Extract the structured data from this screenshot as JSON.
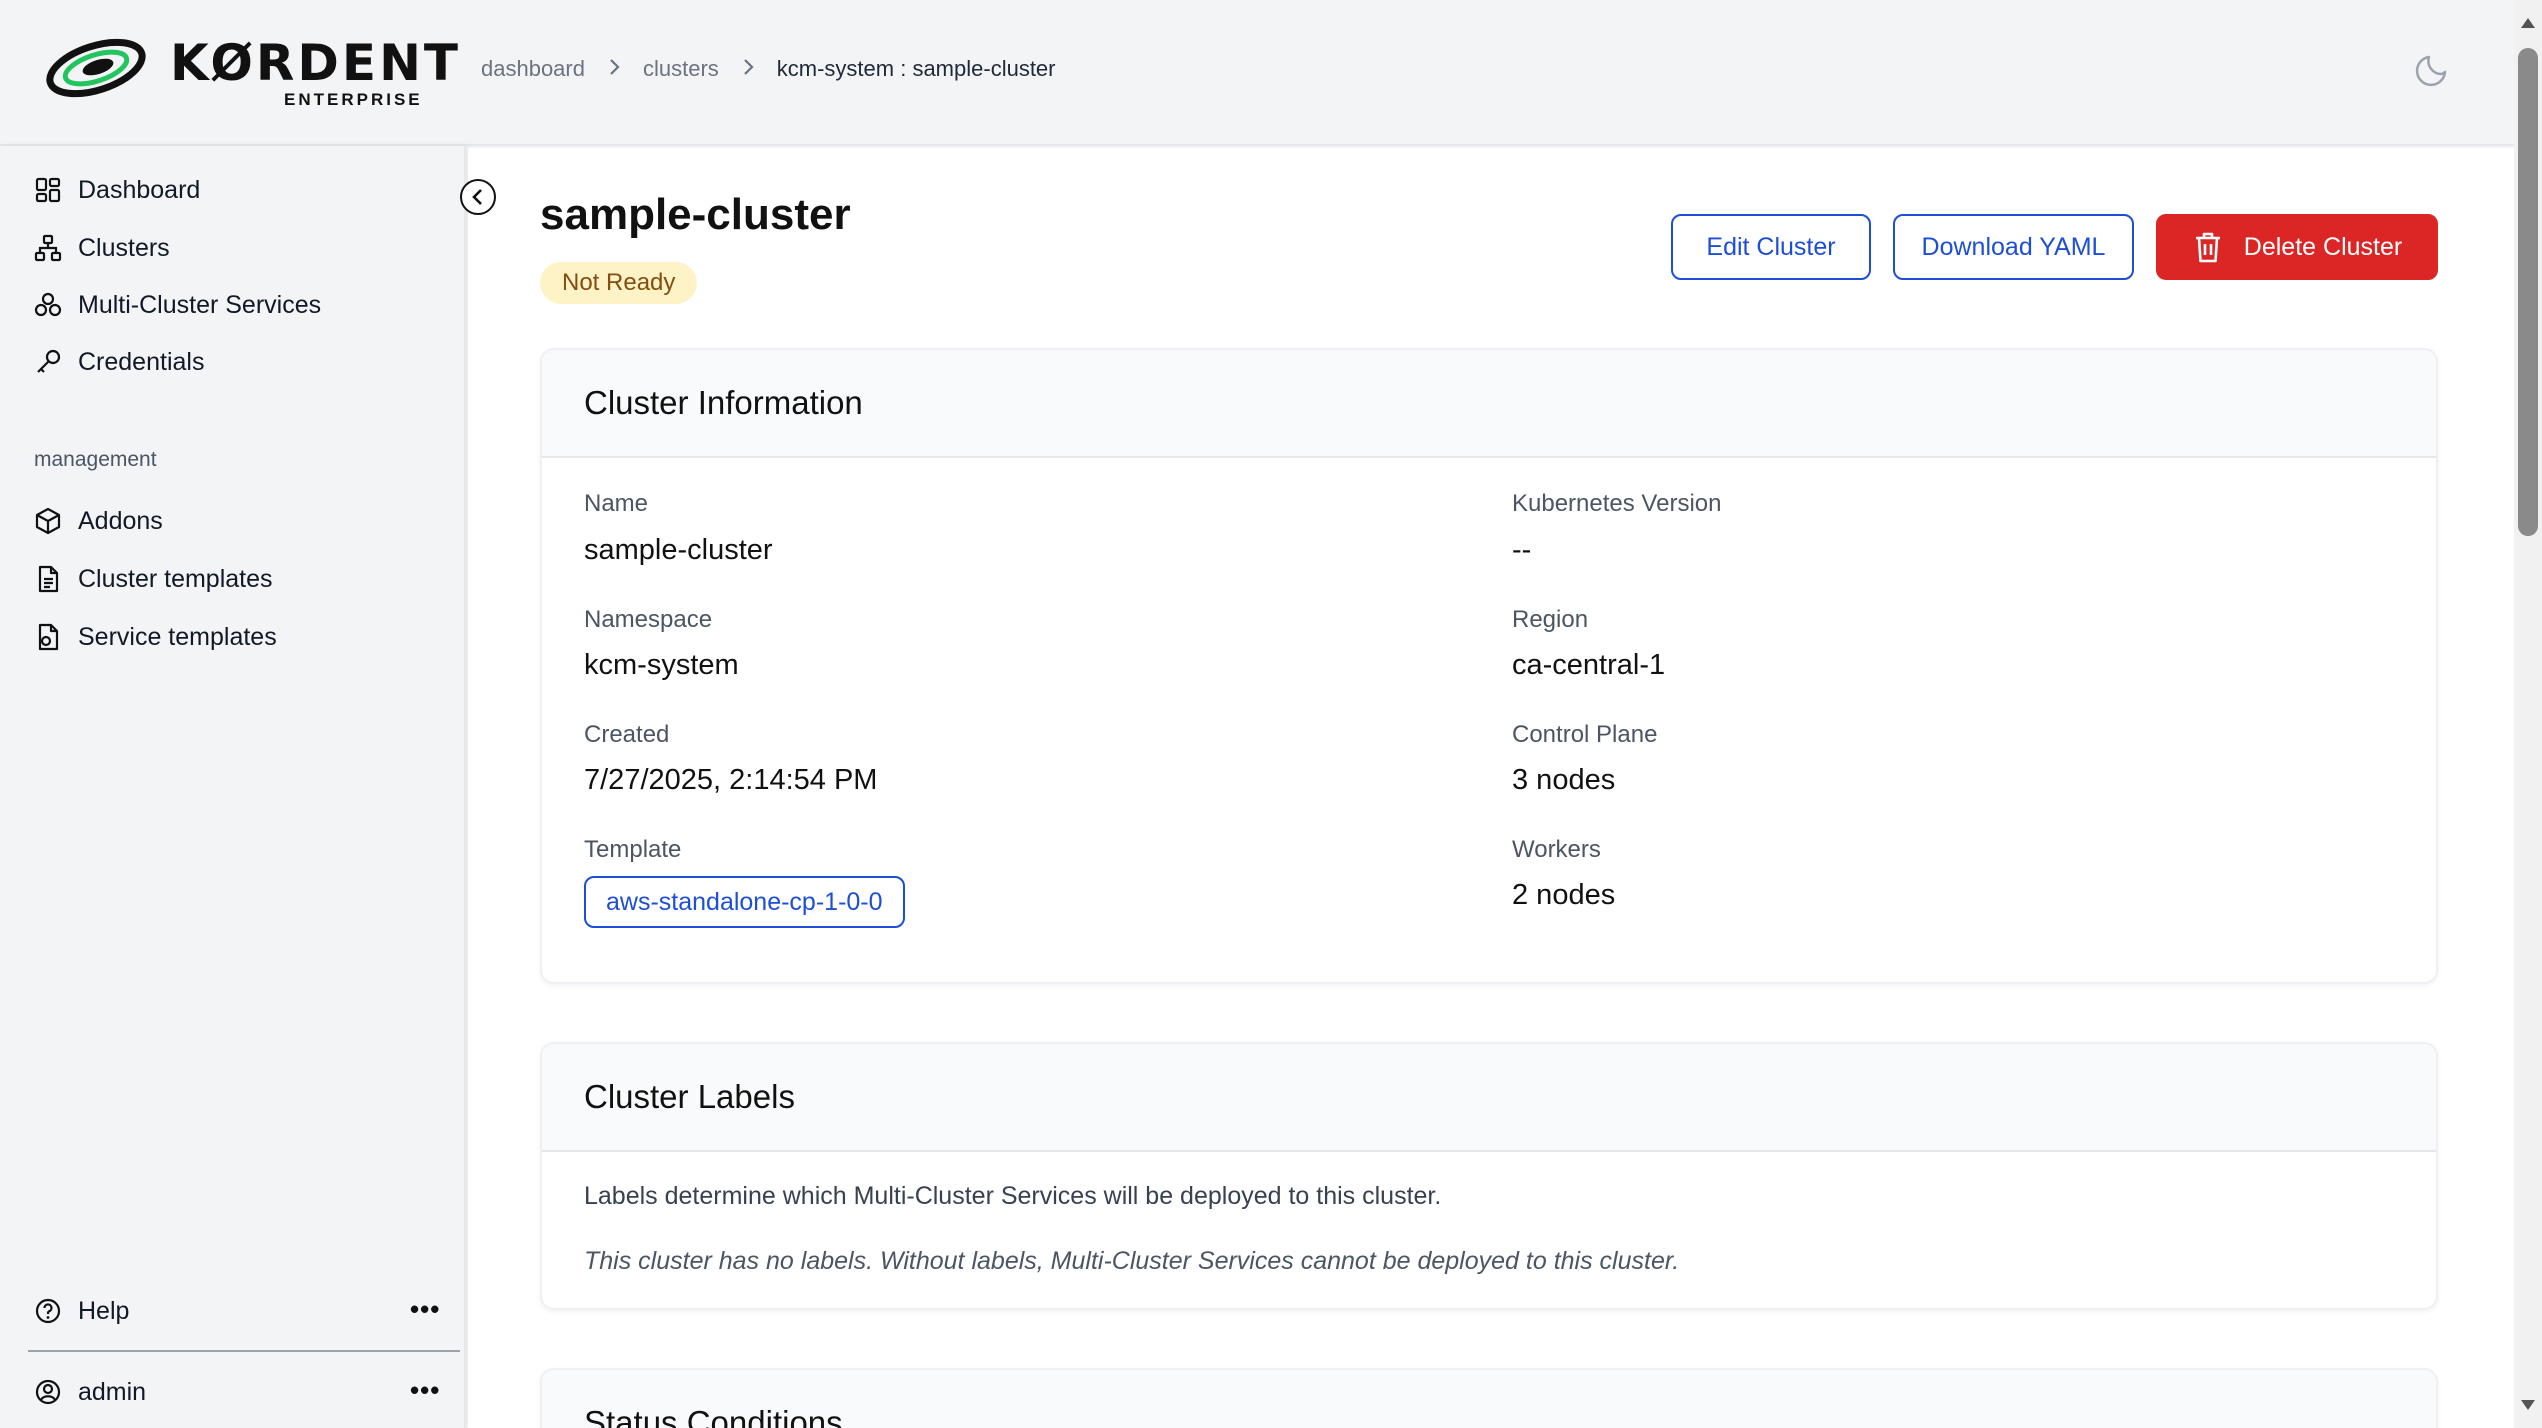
{
  "app": {
    "logo_text": "KØRDENT",
    "logo_subtext": "ENTERPRISE"
  },
  "breadcrumb": {
    "items": [
      "dashboard",
      "clusters",
      "kcm-system : sample-cluster"
    ]
  },
  "header": {
    "theme_icon": "moon-icon"
  },
  "sidebar": {
    "items": [
      {
        "label": "Dashboard",
        "icon": "dashboard-grid-icon"
      },
      {
        "label": "Clusters",
        "icon": "clusters-hierarchy-icon"
      },
      {
        "label": "Multi-Cluster Services",
        "icon": "multi-cluster-icon"
      },
      {
        "label": "Credentials",
        "icon": "key-icon"
      }
    ],
    "management_label": "management",
    "management_items": [
      {
        "label": "Addons",
        "icon": "cube-icon"
      },
      {
        "label": "Cluster templates",
        "icon": "document-icon"
      },
      {
        "label": "Service templates",
        "icon": "document-gear-icon"
      }
    ],
    "help_label": "Help",
    "user_label": "admin",
    "more_glyph": "•••"
  },
  "page": {
    "title": "sample-cluster",
    "status": "Not Ready",
    "actions": {
      "edit": "Edit Cluster",
      "download": "Download YAML",
      "delete": "Delete Cluster"
    }
  },
  "cluster_info": {
    "heading": "Cluster Information",
    "name_label": "Name",
    "name_value": "sample-cluster",
    "namespace_label": "Namespace",
    "namespace_value": "kcm-system",
    "created_label": "Created",
    "created_value": "7/27/2025, 2:14:54 PM",
    "template_label": "Template",
    "template_value": "aws-standalone-cp-1-0-0",
    "k8s_label": "Kubernetes Version",
    "k8s_value": "--",
    "region_label": "Region",
    "region_value": "ca-central-1",
    "control_plane_label": "Control Plane",
    "control_plane_value": "3 nodes",
    "workers_label": "Workers",
    "workers_value": "2 nodes"
  },
  "cluster_labels": {
    "heading": "Cluster Labels",
    "description": "Labels determine which Multi-Cluster Services will be deployed to this cluster.",
    "empty_message": "This cluster has no labels. Without labels, Multi-Cluster Services cannot be deployed to this cluster."
  },
  "status_conditions": {
    "heading": "Status Conditions"
  },
  "colors": {
    "accent": "#1d4ed8",
    "danger": "#dc2626",
    "warning_bg": "#fef3c7",
    "warning_text": "#854d0e"
  }
}
